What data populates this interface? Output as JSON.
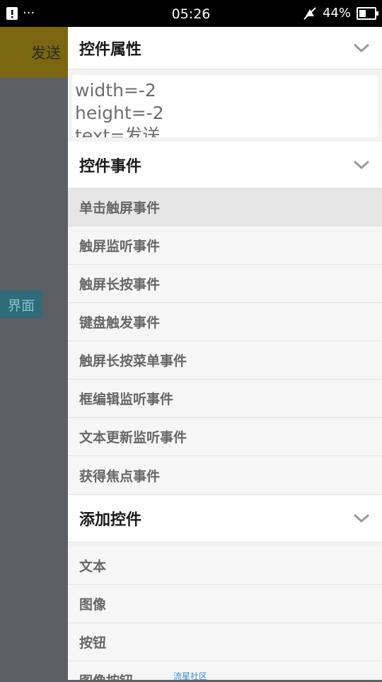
{
  "status_bar": {
    "clock": "05:26",
    "battery_text": "44%",
    "battery_level": 0.44,
    "more_dots": "···"
  },
  "background": {
    "send_label": "发送",
    "interface_label": "界面",
    "accent_color": "#7a6710"
  },
  "panel": {
    "properties": {
      "header": "控件属性",
      "lines": [
        "width=-2",
        "height=-2",
        "text=发送"
      ]
    },
    "events": {
      "header": "控件事件",
      "items": [
        "单击触屏事件",
        "触屏监听事件",
        "触屏长按事件",
        "键盘触发事件",
        "触屏长按菜单事件",
        "框编辑监听事件",
        "文本更新监听事件",
        "获得焦点事件"
      ]
    },
    "add": {
      "header": "添加控件",
      "items": [
        "文本",
        "图像",
        "按钮",
        "图像按钮"
      ]
    }
  },
  "watermark": "流星社区",
  "icons": {
    "notification": "alert-document-icon",
    "mute": "muted-bell-icon",
    "battery": "battery-icon",
    "expand": "chevron-down-icon"
  }
}
